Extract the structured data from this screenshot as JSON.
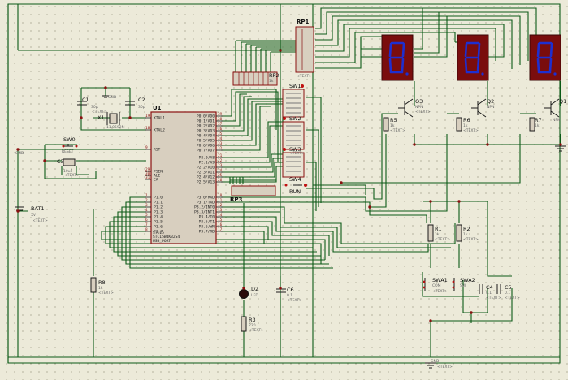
{
  "components": {
    "rp1": {
      "ref": "RP1"
    },
    "rp2": {
      "ref": "RP2",
      "value": "1k"
    },
    "rp3": {
      "ref": "RP3"
    },
    "u1": {
      "ref": "U1",
      "part": "STC15",
      "title_lines": [
        "STC15W4K32S4",
        "USB_PORT"
      ],
      "left_pins": [
        {
          "n": "19",
          "name": "XTAL1"
        },
        {
          "n": "18",
          "name": "XTAL2"
        },
        {
          "n": "9",
          "name": "RST"
        },
        {
          "n": "29",
          "name": "PSEN"
        },
        {
          "n": "30",
          "name": "ALE"
        },
        {
          "n": "31",
          "name": "EA"
        },
        {
          "n": "1",
          "name": "P1.0"
        },
        {
          "n": "2",
          "name": "P1.1"
        },
        {
          "n": "3",
          "name": "P1.2"
        },
        {
          "n": "4",
          "name": "P1.3"
        },
        {
          "n": "5",
          "name": "P1.4"
        },
        {
          "n": "6",
          "name": "P1.5"
        },
        {
          "n": "7",
          "name": "P1.6"
        },
        {
          "n": "8",
          "name": "P1.7"
        }
      ],
      "right_pins": [
        {
          "n": "39",
          "name": "P0.0/AD0"
        },
        {
          "n": "38",
          "name": "P0.1/AD1"
        },
        {
          "n": "37",
          "name": "P0.2/AD2"
        },
        {
          "n": "36",
          "name": "P0.3/AD3"
        },
        {
          "n": "35",
          "name": "P0.4/AD4"
        },
        {
          "n": "34",
          "name": "P0.5/AD5"
        },
        {
          "n": "33",
          "name": "P0.6/AD6"
        },
        {
          "n": "32",
          "name": "P0.7/AD7"
        },
        {
          "n": "21",
          "name": "P2.0/A8"
        },
        {
          "n": "22",
          "name": "P2.1/A9"
        },
        {
          "n": "23",
          "name": "P2.2/A10"
        },
        {
          "n": "24",
          "name": "P2.3/A11"
        },
        {
          "n": "25",
          "name": "P2.4/A12"
        },
        {
          "n": "26",
          "name": "P2.5/A13"
        },
        {
          "n": "10",
          "name": "P3.0/RXD"
        },
        {
          "n": "11",
          "name": "P3.1/TXD"
        },
        {
          "n": "12",
          "name": "P3.2/INT0"
        },
        {
          "n": "13",
          "name": "P3.3/INT1"
        },
        {
          "n": "14",
          "name": "P3.4/T0"
        },
        {
          "n": "15",
          "name": "P3.5/T1"
        },
        {
          "n": "16",
          "name": "P3.6/WR"
        },
        {
          "n": "17",
          "name": "P3.7/RD"
        }
      ]
    },
    "c1": {
      "ref": "C1",
      "value": "30p"
    },
    "c2": {
      "ref": "C2",
      "value": "30p"
    },
    "c3": {
      "ref": "C3",
      "value": "10uF"
    },
    "c4": {
      "ref": "C4",
      "value": "0.1"
    },
    "c5": {
      "ref": "C5",
      "value": "0.1"
    },
    "c6": {
      "ref": "C6",
      "value": "0.1"
    },
    "x1": {
      "ref": "X1",
      "value": "11.0592M"
    },
    "gnd_top": {
      "ref": "GND"
    },
    "gnd_left": {
      "ref": "GND"
    },
    "gnd_bottom": {
      "ref": "GND"
    },
    "sw0": {
      "ref": "SW0",
      "value": "RESET"
    },
    "bat1": {
      "ref": "BAT1",
      "value": "5V"
    },
    "sw_dip1": {
      "ref": "SW1"
    },
    "sw_dip2": {
      "ref": "SW2"
    },
    "sw_dip3": {
      "ref": "SW3"
    },
    "sw4": {
      "ref": "SW4",
      "value": "RUN"
    },
    "q1": {
      "ref": "Q1",
      "type": "NPN"
    },
    "q2": {
      "ref": "Q2",
      "type": "NPN"
    },
    "q3": {
      "ref": "Q3",
      "type": "NPN"
    },
    "r1": {
      "ref": "R1",
      "value": "1k"
    },
    "r2": {
      "ref": "R2",
      "value": "1k"
    },
    "r3": {
      "ref": "R3",
      "value": "220"
    },
    "r5": {
      "ref": "R5",
      "value": "1k"
    },
    "r6": {
      "ref": "R6",
      "value": "1k"
    },
    "r7": {
      "ref": "R7",
      "value": "1k"
    },
    "r8": {
      "ref": "R8",
      "value": "1k"
    },
    "d2": {
      "ref": "D2",
      "value": "LED"
    },
    "swa1": {
      "ref": "SWA1",
      "value": "COM"
    },
    "swa2": {
      "ref": "SWA2",
      "value": "SW"
    },
    "displays": [
      {
        "digit": "8"
      },
      {
        "digit": "8"
      },
      {
        "digit": "8"
      }
    ]
  },
  "placeholder_text": "<TEXT>",
  "colors": {
    "background": "#ecead9",
    "wire": "#0b5a16",
    "display_body": "#7a0d0d",
    "segment": "#1e2fd0",
    "ic_fill": "#d8cfbf",
    "ic_border": "#8a1010",
    "junction": "#8a1010"
  }
}
